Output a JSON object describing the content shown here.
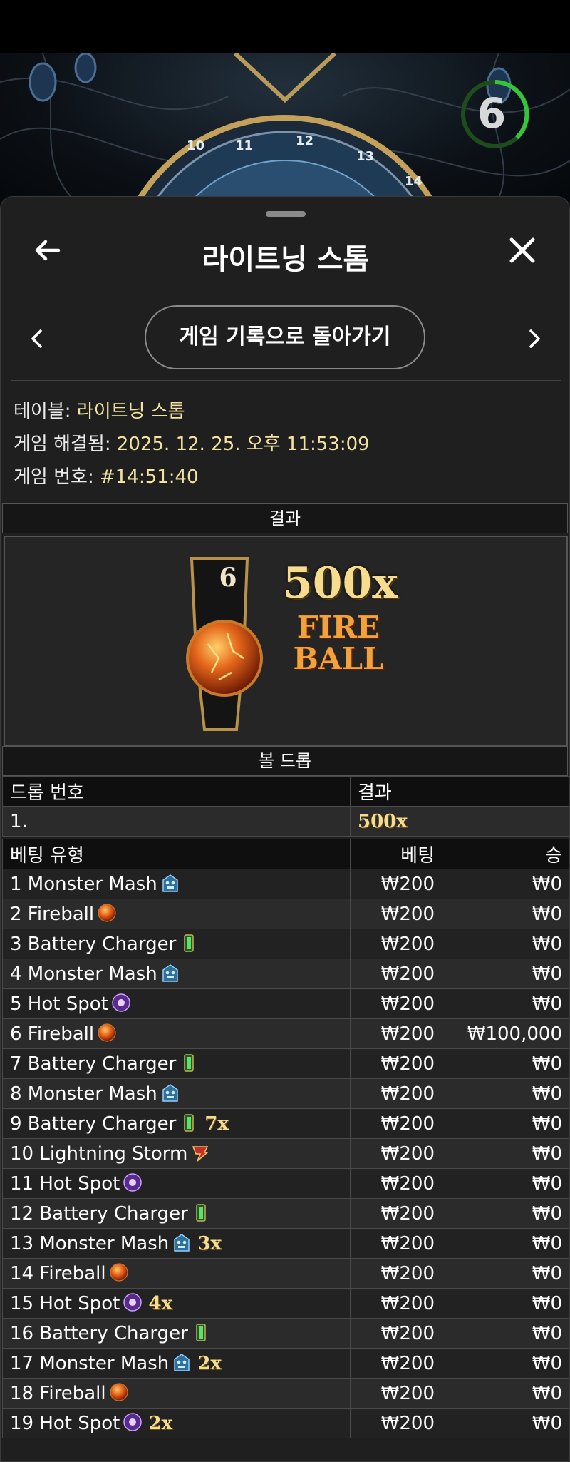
{
  "game": {
    "timer": "6"
  },
  "header": {
    "title": "라이트닝 스톰",
    "back_button": "게임 기록으로 돌아가기"
  },
  "info": {
    "table_label": "테이블:",
    "table_value": "라이트닝 스톰",
    "resolved_label": "게임 해결됨:",
    "resolved_value": "2025. 12. 25. 오후 11:53:09",
    "number_label": "게임 번호:",
    "number_value": "#14:51:40"
  },
  "result": {
    "section_title": "결과",
    "ball_number": "6",
    "multiplier": "500x",
    "bet_type": "FIRE BALL"
  },
  "ball_drop": {
    "section_title": "볼 드롭",
    "col_drop": "드롭 번호",
    "col_result": "결과",
    "rows": [
      {
        "drop": "1.",
        "result": "500x"
      }
    ]
  },
  "bets": {
    "col_type": "베팅 유형",
    "col_bet": "베팅",
    "col_win": "승",
    "rows": [
      {
        "label": "1 Monster Mash",
        "icon": "monster-mash-icon",
        "mult": "",
        "bet": "₩200",
        "win": "₩0"
      },
      {
        "label": "2 Fireball",
        "icon": "fireball-icon",
        "mult": "",
        "bet": "₩200",
        "win": "₩0"
      },
      {
        "label": "3 Battery Charger",
        "icon": "battery-icon",
        "mult": "",
        "bet": "₩200",
        "win": "₩0"
      },
      {
        "label": "4 Monster Mash",
        "icon": "monster-mash-icon",
        "mult": "",
        "bet": "₩200",
        "win": "₩0"
      },
      {
        "label": "5 Hot Spot",
        "icon": "hot-spot-icon",
        "mult": "",
        "bet": "₩200",
        "win": "₩0"
      },
      {
        "label": "6 Fireball",
        "icon": "fireball-icon",
        "mult": "",
        "bet": "₩200",
        "win": "₩100,000"
      },
      {
        "label": "7 Battery Charger",
        "icon": "battery-icon",
        "mult": "",
        "bet": "₩200",
        "win": "₩0"
      },
      {
        "label": "8 Monster Mash",
        "icon": "monster-mash-icon",
        "mult": "",
        "bet": "₩200",
        "win": "₩0"
      },
      {
        "label": "9 Battery Charger",
        "icon": "battery-icon",
        "mult": "7x",
        "bet": "₩200",
        "win": "₩0"
      },
      {
        "label": "10 Lightning Storm",
        "icon": "lightning-storm-icon",
        "mult": "",
        "bet": "₩200",
        "win": "₩0"
      },
      {
        "label": "11 Hot Spot",
        "icon": "hot-spot-icon",
        "mult": "",
        "bet": "₩200",
        "win": "₩0"
      },
      {
        "label": "12 Battery Charger",
        "icon": "battery-icon",
        "mult": "",
        "bet": "₩200",
        "win": "₩0"
      },
      {
        "label": "13 Monster Mash",
        "icon": "monster-mash-icon",
        "mult": "3x",
        "bet": "₩200",
        "win": "₩0"
      },
      {
        "label": "14 Fireball",
        "icon": "fireball-icon",
        "mult": "",
        "bet": "₩200",
        "win": "₩0"
      },
      {
        "label": "15 Hot Spot",
        "icon": "hot-spot-icon",
        "mult": "4x",
        "bet": "₩200",
        "win": "₩0"
      },
      {
        "label": "16 Battery Charger",
        "icon": "battery-icon",
        "mult": "",
        "bet": "₩200",
        "win": "₩0"
      },
      {
        "label": "17 Monster Mash",
        "icon": "monster-mash-icon",
        "mult": "2x",
        "bet": "₩200",
        "win": "₩0"
      },
      {
        "label": "18 Fireball",
        "icon": "fireball-icon",
        "mult": "",
        "bet": "₩200",
        "win": "₩0"
      },
      {
        "label": "19 Hot Spot",
        "icon": "hot-spot-icon",
        "mult": "2x",
        "bet": "₩200",
        "win": "₩0"
      }
    ]
  }
}
